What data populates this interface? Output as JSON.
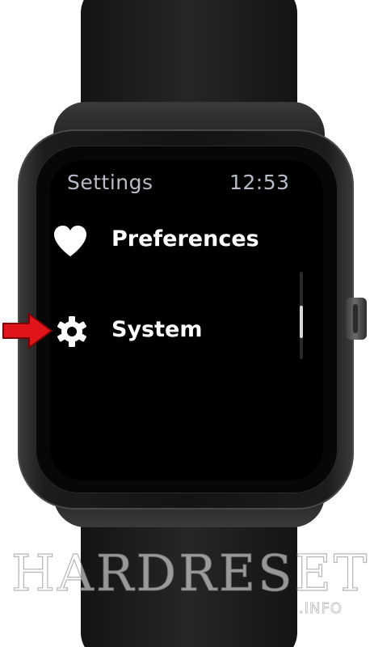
{
  "header": {
    "title": "Settings",
    "time": "12:53"
  },
  "menu": {
    "items": [
      {
        "label": "Preferences",
        "icon": "heart-icon"
      },
      {
        "label": "System",
        "icon": "gear-icon"
      }
    ]
  },
  "scroll": {
    "position_fraction": 0.62
  },
  "watermark": {
    "main": "HARDRESET",
    "sub": ".INFO"
  },
  "colors": {
    "screen_bg": "#000000",
    "text_primary": "#ffffff",
    "text_secondary": "#b8bcc6",
    "arrow": "#e0141a"
  }
}
